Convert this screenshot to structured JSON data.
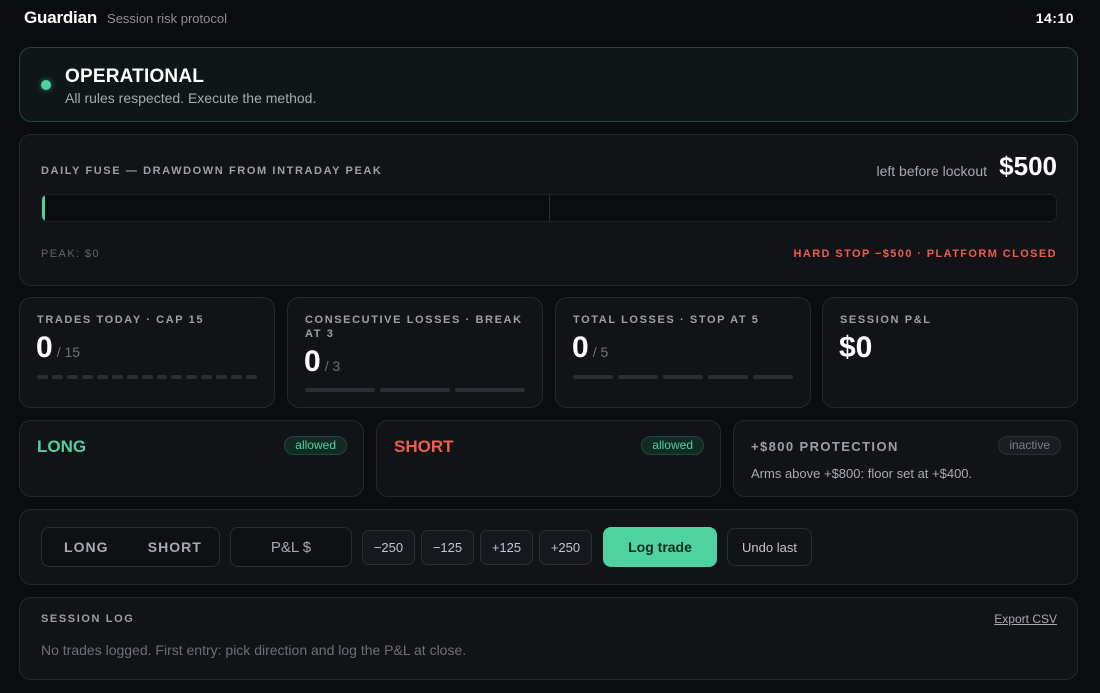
{
  "header": {
    "brand": "Guardian",
    "subtitle": "Session risk protocol",
    "clock": "14:10"
  },
  "status": {
    "title": "OPERATIONAL",
    "message": "All rules respected. Execute the method.",
    "color": "#4fd1a0"
  },
  "fuse": {
    "label": "DAILY FUSE — DRAWDOWN FROM INTRADAY PEAK",
    "left_label": "left before lockout",
    "left_amount": "$500",
    "drawdown_fraction": 0.0,
    "peak": "PEAK: $0",
    "hard_stop": "HARD STOP −$500 · PLATFORM CLOSED",
    "hard_stop_color": "#ef5b4f"
  },
  "stats": [
    {
      "label": "TRADES TODAY · CAP 15",
      "value": "0",
      "cap": "/ 15",
      "segments": 15,
      "filled": 0
    },
    {
      "label": "CONSECUTIVE LOSSES · BREAK AT 3",
      "value": "0",
      "cap": "/ 3",
      "segments": 3,
      "filled": 0
    },
    {
      "label": "TOTAL LOSSES · STOP AT 5",
      "value": "0",
      "cap": "/ 5",
      "segments": 5,
      "filled": 0
    },
    {
      "label": "SESSION P&L",
      "value": "$0"
    }
  ],
  "directions": {
    "long": {
      "name": "LONG",
      "state": "allowed",
      "color": "#4fd1a0"
    },
    "short": {
      "name": "SHORT",
      "state": "allowed",
      "color": "#ef5b4f"
    }
  },
  "protection": {
    "label": "+$800 PROTECTION",
    "state": "inactive",
    "description": "Arms above +$800: floor set at +$400."
  },
  "controls": {
    "long_label": "LONG",
    "short_label": "SHORT",
    "pl_placeholder": "P&L $",
    "quick": [
      "−250",
      "−125",
      "+125",
      "+250"
    ],
    "log_label": "Log trade",
    "undo_label": "Undo last"
  },
  "session_log": {
    "label": "SESSION LOG",
    "export_label": "Export CSV",
    "empty_text": "No trades logged. First entry: pick direction and log the P&L at close."
  }
}
